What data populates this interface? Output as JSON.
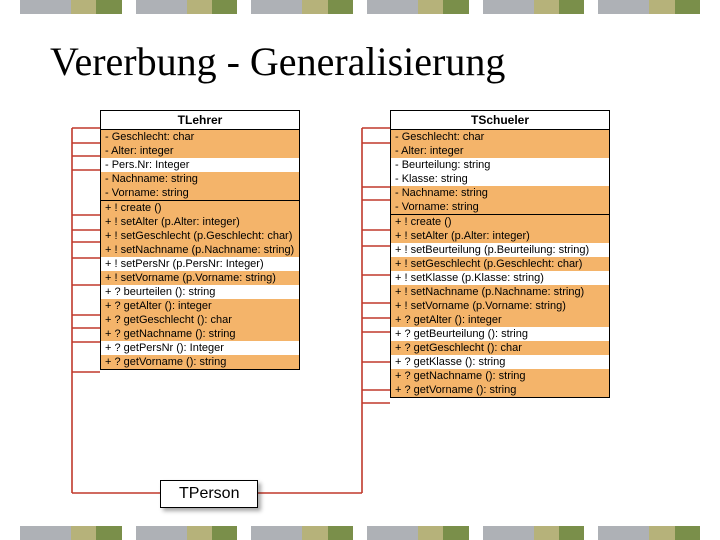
{
  "title": "Vererbung - Generalisierung",
  "lehrer": {
    "name": "TLehrer",
    "attrs": [
      "- Geschlecht: char",
      "- Alter: integer",
      "- Pers.Nr: Integer",
      "- Nachname: string",
      "- Vorname: string"
    ],
    "ops": [
      "+ ! create ()",
      "+ ! setAlter (p.Alter: integer)",
      "+ ! setGeschlecht (p.Geschlecht: char)",
      "+ ! setNachname (p.Nachname: string)",
      "+ ! setPersNr (p.PersNr: Integer)",
      "+ ! setVorname (p.Vorname: string)",
      "+ ? beurteilen (): string",
      "+ ? getAlter (): integer",
      "+ ? getGeschlecht (): char",
      "+ ? getNachname (): string",
      "+ ? getPersNr (): Integer",
      "+ ? getVorname (): string"
    ]
  },
  "schueler": {
    "name": "TSchueler",
    "attrs": [
      "- Geschlecht: char",
      "- Alter: integer",
      "- Beurteilung: string",
      "- Klasse: string",
      "- Nachname: string",
      "- Vorname: string"
    ],
    "ops": [
      "+ ! create ()",
      "+ ! setAlter (p.Alter: integer)",
      "+ ! setBeurteilung (p.Beurteilung: string)",
      "+ ! setGeschlecht (p.Geschlecht: char)",
      "+ ! setKlasse (p.Klasse: string)",
      "+ ! setNachname (p.Nachname: string)",
      "+ ! setVorname (p.Vorname: string)",
      "+ ? getAlter (): integer",
      "+ ? getBeurteilung (): string",
      "+ ? getGeschlecht (): char",
      "+ ? getKlasse (): string",
      "+ ? getNachname (): string",
      "+ ? getVorname (): string"
    ]
  },
  "person_label": "TPerson",
  "highlight_color": "#f4b46a",
  "lehrer_highlight_attrs": [
    0,
    1,
    3,
    4
  ],
  "lehrer_highlight_ops": [
    0,
    1,
    2,
    3,
    5,
    7,
    8,
    9,
    11
  ],
  "schueler_highlight_attrs": [
    0,
    1,
    4,
    5
  ],
  "schueler_highlight_ops": [
    0,
    1,
    3,
    5,
    6,
    7,
    9,
    11,
    12
  ],
  "lehrer_lines_y": [
    18,
    33,
    46,
    60,
    105,
    120,
    132,
    148,
    175,
    205,
    218,
    232,
    262
  ],
  "schueler_lines_y": [
    18,
    33,
    77,
    90,
    120,
    136,
    165,
    193,
    208,
    222,
    252,
    280,
    293
  ]
}
